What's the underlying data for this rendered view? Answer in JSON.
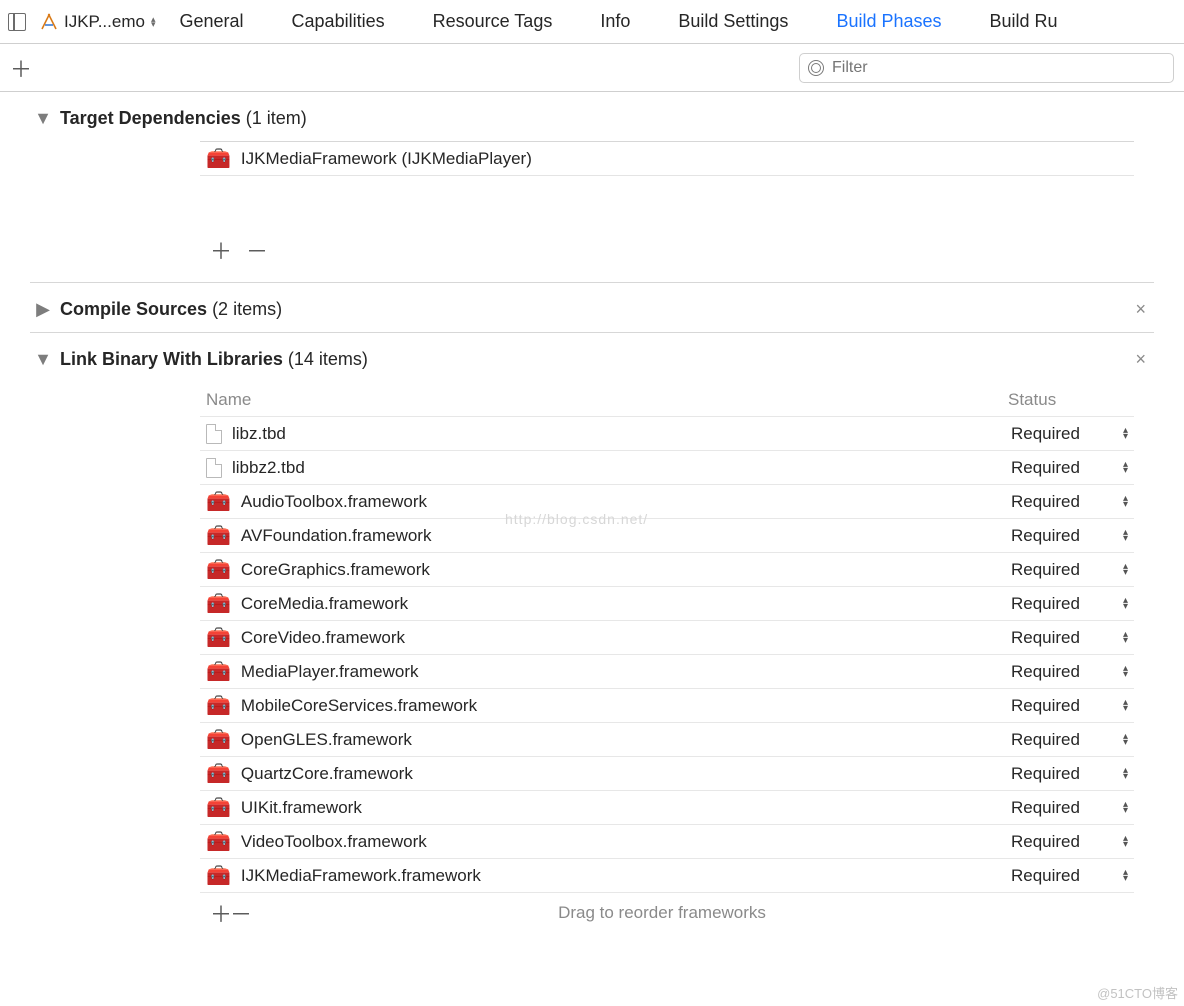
{
  "topbar": {
    "target_name": "IJKP...emo",
    "tabs": [
      {
        "label": "General"
      },
      {
        "label": "Capabilities"
      },
      {
        "label": "Resource Tags"
      },
      {
        "label": "Info"
      },
      {
        "label": "Build Settings"
      },
      {
        "label": "Build Phases",
        "active": true
      },
      {
        "label": "Build Ru"
      }
    ]
  },
  "filter": {
    "placeholder": "Filter"
  },
  "sections": {
    "target_deps": {
      "title": "Target Dependencies",
      "count_label": "(1 item)",
      "items": [
        {
          "name": "IJKMediaFramework (IJKMediaPlayer)",
          "icon": "toolbox"
        }
      ]
    },
    "compile_sources": {
      "title": "Compile Sources",
      "count_label": "(2 items)"
    },
    "link_bin": {
      "title": "Link Binary With Libraries",
      "count_label": "(14 items)",
      "headers": {
        "name": "Name",
        "status": "Status"
      },
      "drag_hint": "Drag to reorder frameworks",
      "status_label": "Required",
      "items": [
        {
          "name": "libz.tbd",
          "icon": "file",
          "status": "Required"
        },
        {
          "name": "libbz2.tbd",
          "icon": "file",
          "status": "Required"
        },
        {
          "name": "AudioToolbox.framework",
          "icon": "toolbox",
          "status": "Required"
        },
        {
          "name": "AVFoundation.framework",
          "icon": "toolbox",
          "status": "Required"
        },
        {
          "name": "CoreGraphics.framework",
          "icon": "toolbox",
          "status": "Required"
        },
        {
          "name": "CoreMedia.framework",
          "icon": "toolbox",
          "status": "Required"
        },
        {
          "name": "CoreVideo.framework",
          "icon": "toolbox",
          "status": "Required"
        },
        {
          "name": "MediaPlayer.framework",
          "icon": "toolbox",
          "status": "Required"
        },
        {
          "name": "MobileCoreServices.framework",
          "icon": "toolbox",
          "status": "Required"
        },
        {
          "name": "OpenGLES.framework",
          "icon": "toolbox",
          "status": "Required"
        },
        {
          "name": "QuartzCore.framework",
          "icon": "toolbox",
          "status": "Required"
        },
        {
          "name": "UIKit.framework",
          "icon": "toolbox",
          "status": "Required"
        },
        {
          "name": "VideoToolbox.framework",
          "icon": "toolbox",
          "status": "Required"
        },
        {
          "name": "IJKMediaFramework.framework",
          "icon": "toolbox",
          "status": "Required"
        }
      ]
    }
  },
  "watermark": "http://blog.csdn.net/",
  "footer": "@51CTO博客"
}
